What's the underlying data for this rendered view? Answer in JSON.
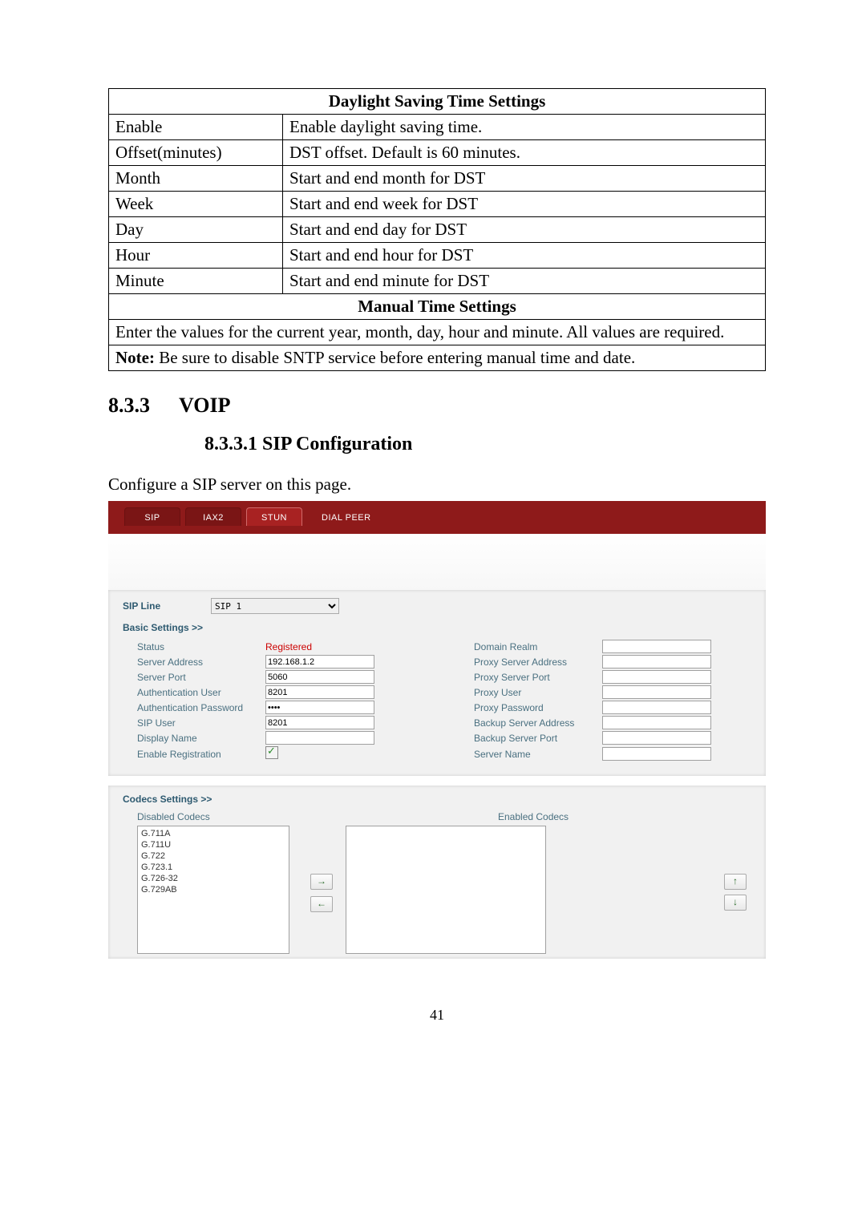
{
  "dst_table": {
    "header": "Daylight Saving Time Settings",
    "rows": [
      {
        "k": "Enable",
        "v": "Enable daylight saving time."
      },
      {
        "k": "Offset(minutes)",
        "v": "DST offset.    Default is 60 minutes."
      },
      {
        "k": "Month",
        "v": "Start and end month for DST"
      },
      {
        "k": "Week",
        "v": "Start and end week for DST"
      },
      {
        "k": "Day",
        "v": "Start and end day for DST"
      },
      {
        "k": "Hour",
        "v": "Start and end hour for DST"
      },
      {
        "k": "Minute",
        "v": "Start and end minute for DST"
      }
    ],
    "subheader": "Manual Time Settings",
    "line1": "Enter the values for the current year, month, day, hour and minute.    All values are required.",
    "line2_prefix_bold": "Note:",
    "line2_rest": " Be sure to disable SNTP service before entering manual time and date."
  },
  "heading_833_num": "8.3.3",
  "heading_833_text": "VOIP",
  "heading_8331": "8.3.3.1   SIP Configuration",
  "intro": "Configure a SIP server on this page.",
  "tabs": {
    "sip": "SIP",
    "iax2": "IAX2",
    "stun": "STUN",
    "dialpeer": "DIAL PEER"
  },
  "sip_line": {
    "label": "SIP Line",
    "selected": "SIP 1"
  },
  "basic": {
    "title": "Basic Settings >>",
    "left": {
      "status_label": "Status",
      "status_value": "Registered",
      "server_address_label": "Server Address",
      "server_address_value": "192.168.1.2",
      "server_port_label": "Server Port",
      "server_port_value": "5060",
      "auth_user_label": "Authentication User",
      "auth_user_value": "8201",
      "auth_pw_label": "Authentication Password",
      "auth_pw_value": "••••",
      "sip_user_label": "SIP User",
      "sip_user_value": "8201",
      "display_name_label": "Display Name",
      "display_name_value": "",
      "enable_reg_label": "Enable Registration"
    },
    "right": {
      "domain_realm_label": "Domain Realm",
      "proxy_addr_label": "Proxy Server Address",
      "proxy_port_label": "Proxy Server Port",
      "proxy_user_label": "Proxy User",
      "proxy_pw_label": "Proxy Password",
      "backup_addr_label": "Backup Server Address",
      "backup_port_label": "Backup Server Port",
      "server_name_label": "Server Name"
    }
  },
  "codecs": {
    "title": "Codecs Settings >>",
    "disabled_label": "Disabled Codecs",
    "enabled_label": "Enabled Codecs",
    "disabled_items": [
      "G.711A",
      "G.711U",
      "G.722",
      "G.723.1",
      "G.726-32",
      "G.729AB"
    ],
    "arrow_right": "→",
    "arrow_left": "←",
    "arrow_up": "↑",
    "arrow_down": "↓"
  },
  "page_number": "41"
}
